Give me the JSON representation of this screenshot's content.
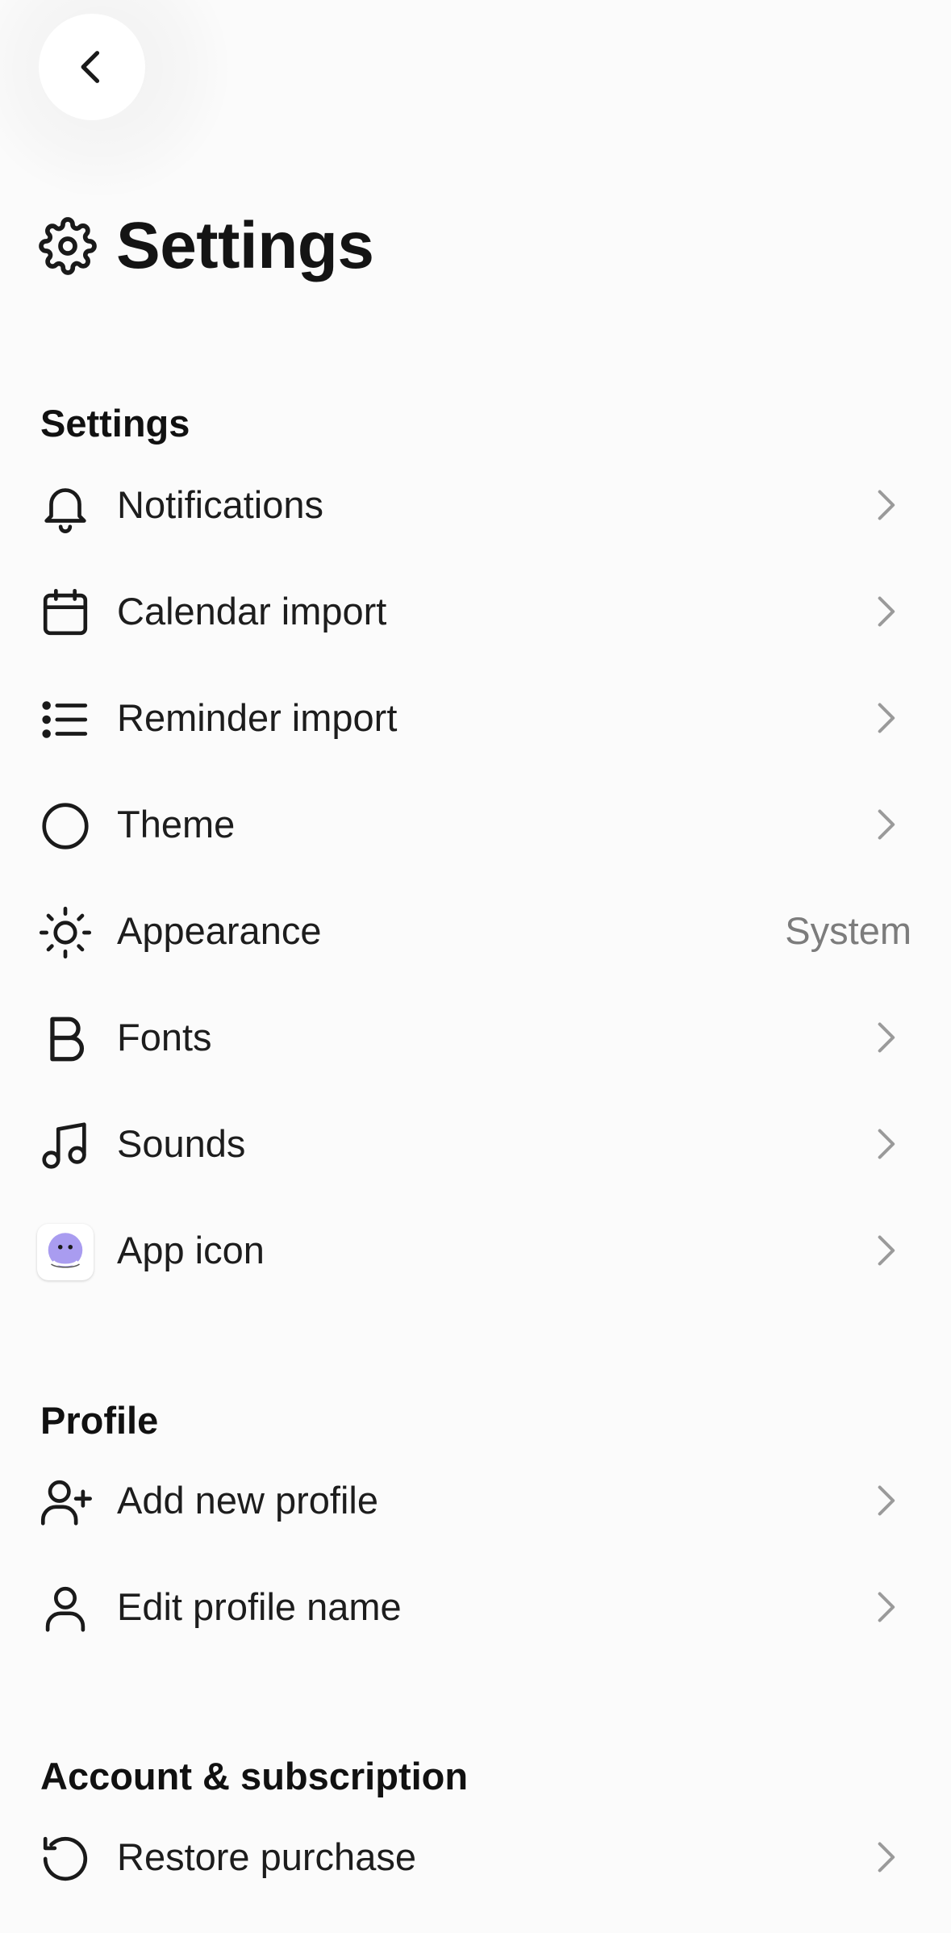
{
  "header": {
    "back_icon": "chevron-left-icon"
  },
  "page": {
    "title": "Settings",
    "title_icon": "gear-icon"
  },
  "sections": {
    "settings": {
      "header": "Settings",
      "items": [
        {
          "label": "Notifications",
          "icon": "bell-icon"
        },
        {
          "label": "Calendar import",
          "icon": "calendar-icon"
        },
        {
          "label": "Reminder import",
          "icon": "list-icon"
        },
        {
          "label": "Theme",
          "icon": "circle-icon"
        },
        {
          "label": "Appearance",
          "icon": "sun-icon",
          "value": "System"
        },
        {
          "label": "Fonts",
          "icon": "bold-b-icon"
        },
        {
          "label": "Sounds",
          "icon": "music-note-icon"
        },
        {
          "label": "App icon",
          "icon": "app-icon-thumbnail"
        }
      ]
    },
    "profile": {
      "header": "Profile",
      "items": [
        {
          "label": "Add new profile",
          "icon": "user-plus-icon"
        },
        {
          "label": "Edit profile name",
          "icon": "user-icon"
        }
      ]
    },
    "account": {
      "header": "Account & subscription",
      "items": [
        {
          "label": "Restore purchase",
          "icon": "restore-icon"
        }
      ]
    }
  },
  "colors": {
    "background": "#fbfbfb",
    "text": "#1b1b1b",
    "secondary_text": "#7c7c7c",
    "chevron": "#9a9a9a",
    "app_icon_purple": "#a99cf0"
  }
}
